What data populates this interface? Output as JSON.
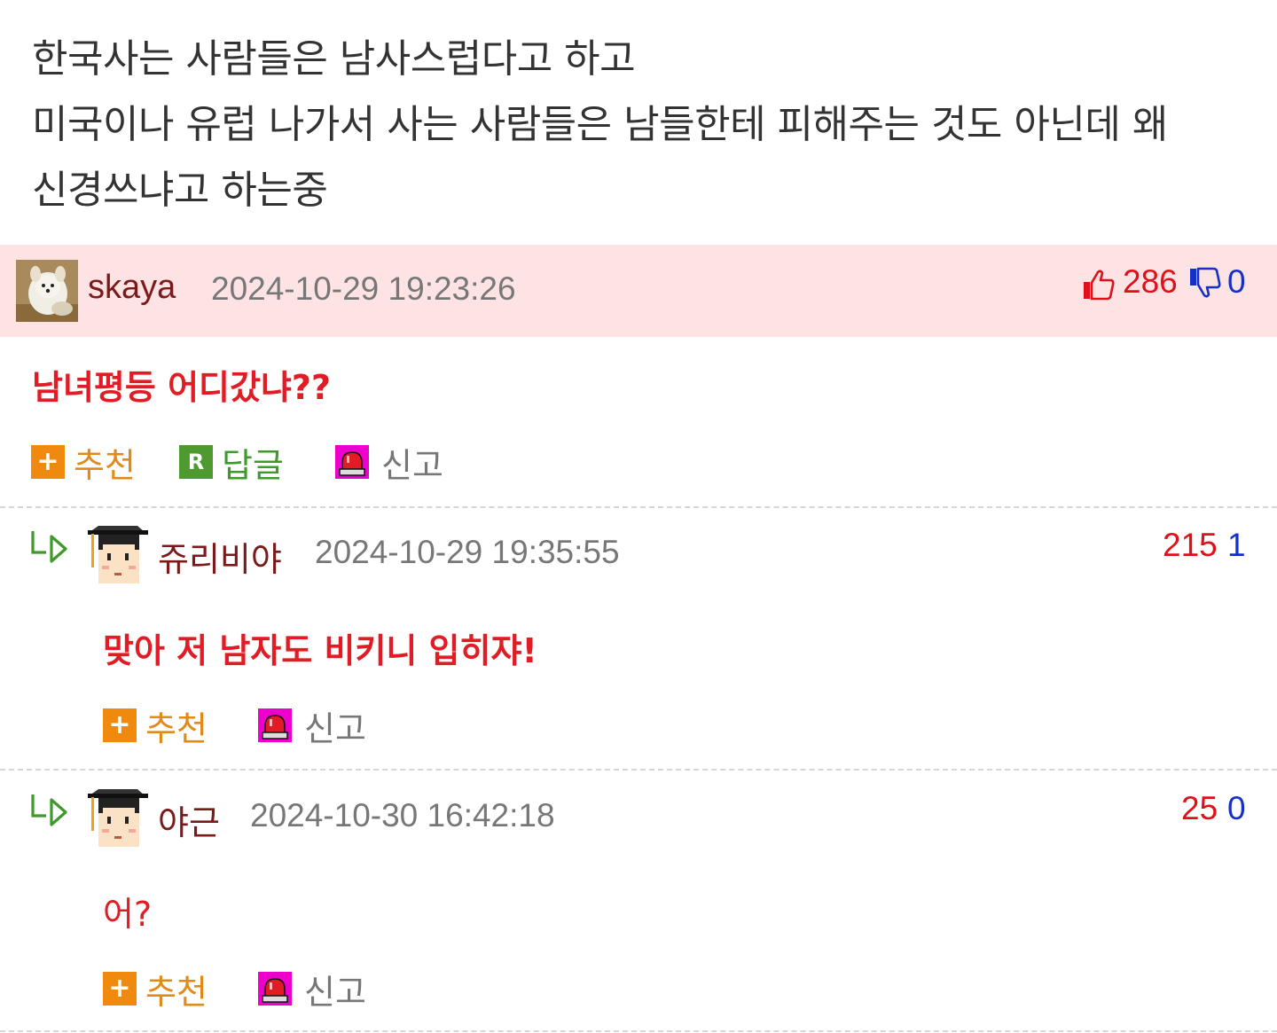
{
  "post": {
    "lines": [
      "한국사는 사람들은 남사스럽다고 하고",
      "미국이나 유럽 나가서 사는 사람들은 남들한테 피해주는 것도 아닌데 왜",
      "신경쓰냐고 하는중"
    ]
  },
  "actions": {
    "recommend": "추천",
    "reply": "답글",
    "report": "신고"
  },
  "comments": [
    {
      "username": "skaya",
      "datetime": "2024-10-29 19:23:26",
      "upvotes": "286",
      "downvotes": "0",
      "text": "남녀평등 어디갔냐??",
      "best": true,
      "avatar": "dog-avatar"
    },
    {
      "username": "쥬리비야",
      "datetime": "2024-10-29 19:35:55",
      "upvotes": "215",
      "downvotes": "1",
      "text": "맞아 저 남자도 비키니 입히쟈!",
      "reply": true,
      "avatar": "graduate-avatar"
    },
    {
      "username": "야근",
      "datetime": "2024-10-30 16:42:18",
      "upvotes": "25",
      "downvotes": "0",
      "text": "어?",
      "reply": true,
      "avatar": "graduate-avatar"
    }
  ],
  "colors": {
    "best_bg": "#fde3e4",
    "username": "#7a1a1a",
    "comment_text": "#e21c24",
    "upvote": "#e0101a",
    "downvote": "#1530c8",
    "recommend_icon": "#f08a0e",
    "reply_icon": "#4e9a2e",
    "report_icon": "#ee00cc"
  }
}
